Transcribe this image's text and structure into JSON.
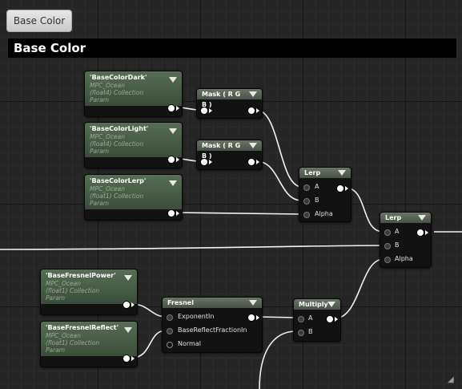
{
  "tab": {
    "label": "Base Color"
  },
  "comment": {
    "title": "Base Color"
  },
  "params": {
    "dark": {
      "title": "'BaseColorDark'",
      "source": "MPC_Ocean",
      "kind": "(float4) Collection Param"
    },
    "light": {
      "title": "'BaseColorLight'",
      "source": "MPC_Ocean",
      "kind": "(float4) Collection Param"
    },
    "lerp": {
      "title": "'BaseColorLerp'",
      "source": "MPC_Ocean",
      "kind": "(float1) Collection Param"
    },
    "power": {
      "title": "'BaseFresnelPower'",
      "source": "MPC_Ocean",
      "kind": "(float1) Collection Param"
    },
    "reflect": {
      "title": "'BaseFresnelReflect'",
      "source": "MPC_Ocean",
      "kind": "(float1) Collection Param"
    }
  },
  "mask1": {
    "title": "Mask ( R G B )"
  },
  "mask2": {
    "title": "Mask ( R G B )"
  },
  "lerp1": {
    "title": "Lerp",
    "pins": [
      "A",
      "B",
      "Alpha"
    ]
  },
  "lerp2": {
    "title": "Lerp",
    "pins": [
      "A",
      "B",
      "Alpha"
    ]
  },
  "fresnel": {
    "title": "Fresnel",
    "pins": [
      "ExponentIn",
      "BaseReflectFractionIn",
      "Normal"
    ]
  },
  "multiply": {
    "title": "Multiply",
    "pins": [
      "A",
      "B"
    ]
  }
}
